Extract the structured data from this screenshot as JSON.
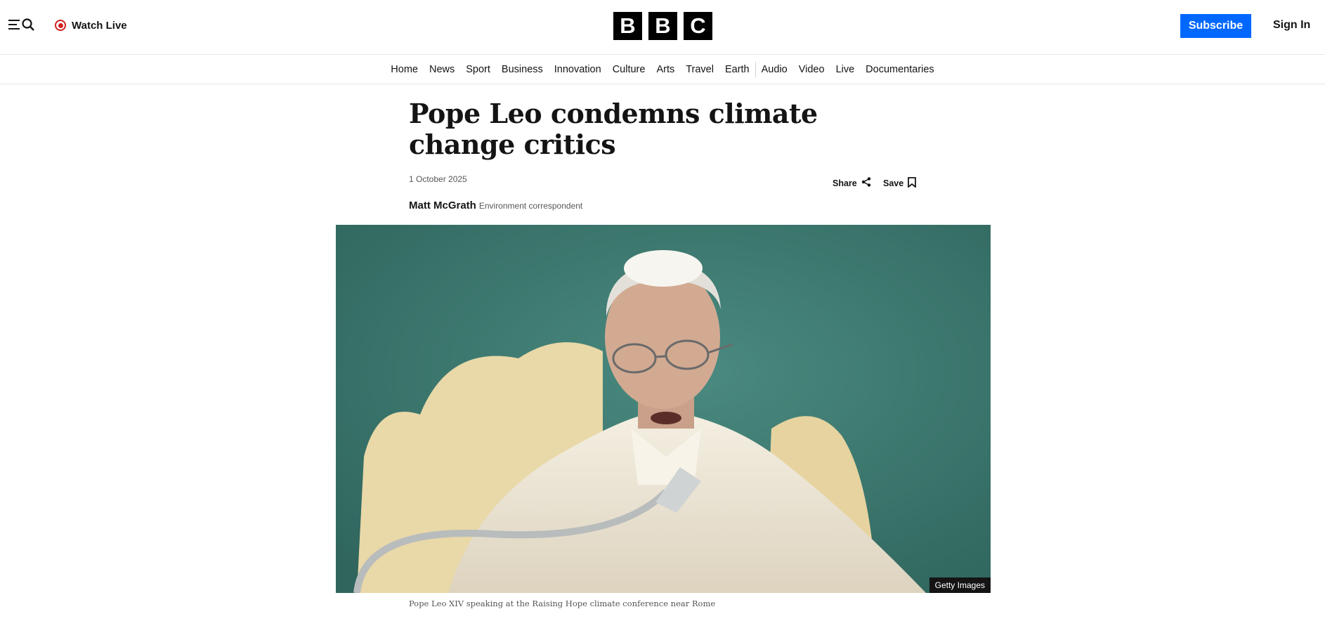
{
  "header": {
    "watch_live_label": "Watch Live",
    "logo_letters": [
      "B",
      "B",
      "C"
    ],
    "subscribe_label": "Subscribe",
    "signin_label": "Sign In"
  },
  "nav": {
    "items": [
      "Home",
      "News",
      "Sport",
      "Business",
      "Innovation",
      "Culture",
      "Arts",
      "Travel",
      "Earth",
      "Audio",
      "Video",
      "Live",
      "Documentaries"
    ]
  },
  "article": {
    "headline": "Pope Leo condemns climate change critics",
    "date": "1 October 2025",
    "share_label": "Share",
    "save_label": "Save",
    "author": "Matt McGrath",
    "role": "Environment correspondent",
    "image_credit": "Getty Images",
    "caption": "Pope Leo XIV speaking at the Raising Hope climate conference near Rome"
  },
  "colors": {
    "accent": "#0068ff",
    "live": "#d42020",
    "photo_background": "#3a736b"
  },
  "icons": [
    "menu-icon",
    "search-icon",
    "live-indicator-icon",
    "share-icon",
    "bookmark-icon"
  ]
}
